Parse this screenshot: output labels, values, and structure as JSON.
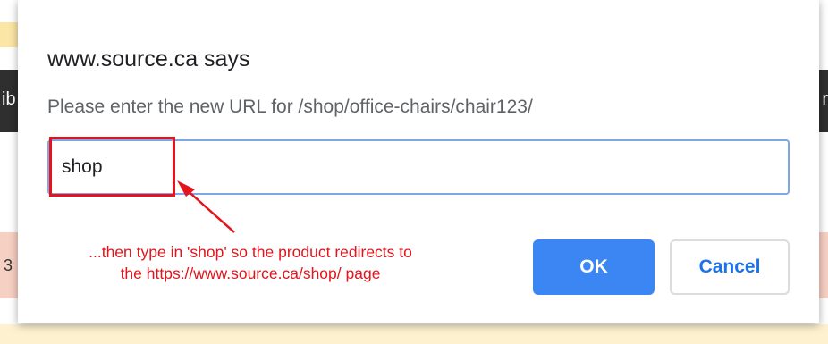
{
  "dialog": {
    "title": "www.source.ca says",
    "message": "Please enter the new URL for /shop/office-chairs/chair123/",
    "input_value": "shop",
    "ok_label": "OK",
    "cancel_label": "Cancel"
  },
  "annotation": {
    "line1": "...then type in 'shop' so the product redirects to",
    "line2": "the https://www.source.ca/shop/ page",
    "color": "#e3141c"
  },
  "background": {
    "left_fragment": "ib",
    "right_fragment": "r",
    "left_number": "3"
  },
  "colors": {
    "accent": "#3c86f4",
    "cancel_text": "#1a73e8",
    "input_border": "#7fa7e6"
  }
}
